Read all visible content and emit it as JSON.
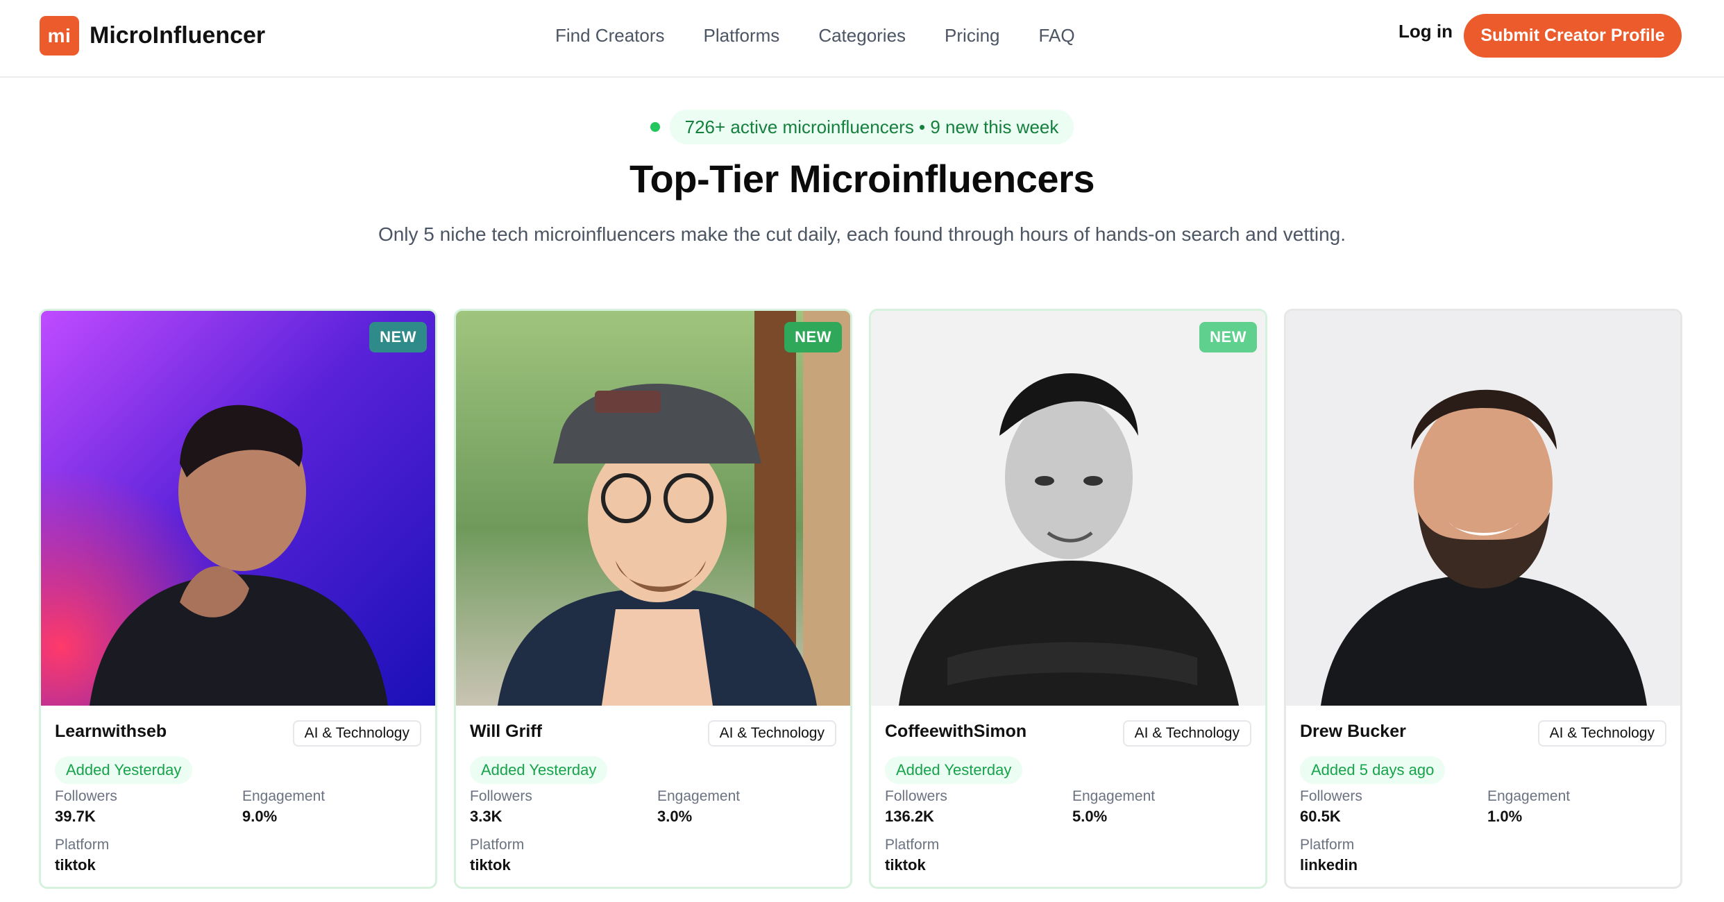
{
  "brand": {
    "logo_text": "mi",
    "name": "MicroInfluencer"
  },
  "nav": [
    "Find Creators",
    "Platforms",
    "Categories",
    "Pricing",
    "FAQ"
  ],
  "header": {
    "login": "Log in",
    "cta": "Submit Creator Profile"
  },
  "hero": {
    "status": "726+ active microinfluencers • 9 new this week",
    "title": "Top-Tier Microinfluencers",
    "subtitle": "Only 5 niche tech microinfluencers make the cut daily, each found through hours of hands-on search and vetting."
  },
  "labels": {
    "followers": "Followers",
    "engagement": "Engagement",
    "platform": "Platform"
  },
  "cards": [
    {
      "name": "Learnwithseb",
      "category": "AI & Technology",
      "added": "Added Yesterday",
      "followers": "39.7K",
      "engagement": "9.0%",
      "platform": "tiktok",
      "badge": "NEW",
      "badge_color": "#2f8a8a"
    },
    {
      "name": "Will Griff",
      "category": "AI & Technology",
      "added": "Added Yesterday",
      "followers": "3.3K",
      "engagement": "3.0%",
      "platform": "tiktok",
      "badge": "NEW",
      "badge_color": "#2fa85a"
    },
    {
      "name": "CoffeewithSimon",
      "category": "AI & Technology",
      "added": "Added Yesterday",
      "followers": "136.2K",
      "engagement": "5.0%",
      "platform": "tiktok",
      "badge": "NEW",
      "badge_color": "#5fd08e"
    },
    {
      "name": "Drew Bucker",
      "category": "AI & Technology",
      "added": "Added 5 days ago",
      "followers": "60.5K",
      "engagement": "1.0%",
      "platform": "linkedin"
    }
  ],
  "colors": {
    "accent": "#ec5b2c",
    "success": "#16a34a",
    "success_bg": "#ecfdf3"
  }
}
